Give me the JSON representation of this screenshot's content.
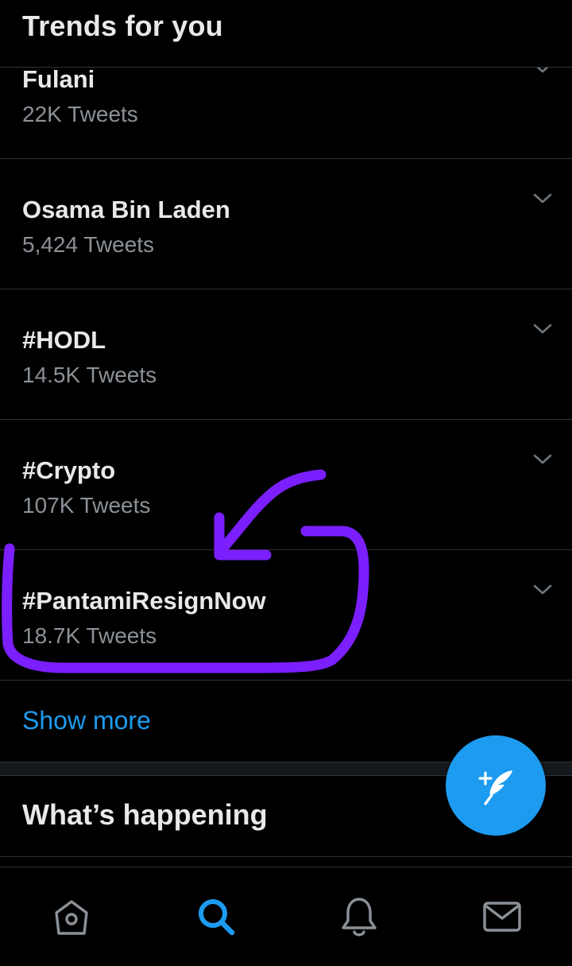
{
  "header": {
    "title": "Trends for you"
  },
  "trends": [
    {
      "title": "Fulani",
      "count": "22K Tweets"
    },
    {
      "title": "Osama Bin Laden",
      "count": "5,424 Tweets"
    },
    {
      "title": "#HODL",
      "count": "14.5K Tweets"
    },
    {
      "title": "#Crypto",
      "count": "107K Tweets"
    },
    {
      "title": "#PantamiResignNow",
      "count": "18.7K Tweets"
    }
  ],
  "show_more": "Show more",
  "whats_happening": "What’s happening",
  "tabs": [
    {
      "name": "home",
      "icon": "home-icon",
      "active": false
    },
    {
      "name": "search",
      "icon": "search-icon",
      "active": true
    },
    {
      "name": "notifications",
      "icon": "bell-icon",
      "active": false
    },
    {
      "name": "messages",
      "icon": "mail-icon",
      "active": false
    }
  ],
  "fab": {
    "icon": "compose-tweet-icon"
  },
  "colors": {
    "background": "#000000",
    "accent": "#1d9bf0",
    "text_primary": "#e7e9ea",
    "text_secondary": "#8b9197",
    "annotation": "#7b1fff"
  }
}
